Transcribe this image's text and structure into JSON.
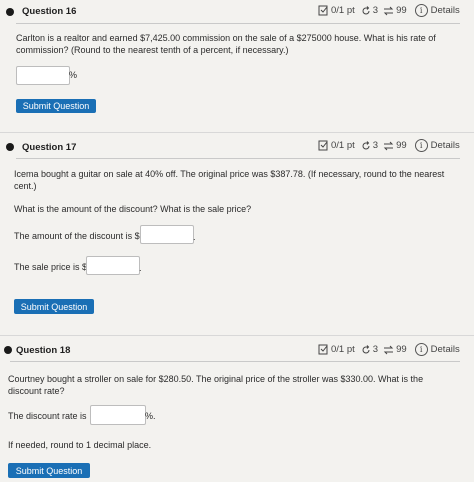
{
  "questions": [
    {
      "title": "Question 16",
      "score": "0/1 pt",
      "retries": "3",
      "attempts": "99",
      "details": "Details",
      "text": "Carlton is a realtor and earned $7,425.00 commission on the sale of a $275000 house. What is his rate of commission? (Round to the nearest tenth of a percent, if necessary.)",
      "unit": "%",
      "submit": "Submit Question"
    },
    {
      "title": "Question 17",
      "score": "0/1 pt",
      "retries": "3",
      "attempts": "99",
      "details": "Details",
      "text": "Icema bought a guitar on sale at 40% off. The original price was $387.78. (If necessary, round to the nearest cent.)",
      "prompt": "What is the amount of the discount?  What is the sale price?",
      "discount_label": "The amount of the discount is $",
      "sale_label": "The sale price is $",
      "period": ".",
      "submit": "Submit Question"
    },
    {
      "title": "Question 18",
      "score": "0/1 pt",
      "retries": "3",
      "attempts": "99",
      "details": "Details",
      "text": "Courtney bought a stroller on sale for $280.50. The original price of the stroller was $330.00. What is the discount rate?",
      "rate_label": "The discount rate is",
      "unit": "%.",
      "note": "If needed, round to 1 decimal place.",
      "submit": "Submit Question"
    }
  ],
  "icons": [
    "edit-score-icon",
    "retry-icon",
    "attempts-icon",
    "info-icon"
  ],
  "colors": {
    "button": "#1a6fb5",
    "background": "#f3f2ef",
    "field_border": "#bdbdbd"
  }
}
